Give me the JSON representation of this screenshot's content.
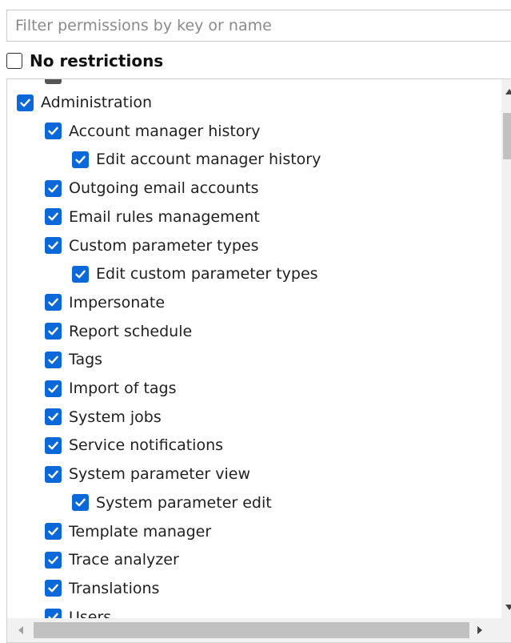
{
  "filter": {
    "placeholder": "Filter permissions by key or name",
    "value": ""
  },
  "no_restrictions": {
    "label": "No restrictions",
    "checked": false
  },
  "tree": {
    "partial_top_item": {
      "checked": true
    },
    "items": [
      {
        "label": "Administration",
        "level": 0,
        "checked": true
      },
      {
        "label": "Account manager history",
        "level": 1,
        "checked": true
      },
      {
        "label": "Edit account manager history",
        "level": 2,
        "checked": true
      },
      {
        "label": "Outgoing email accounts",
        "level": 1,
        "checked": true
      },
      {
        "label": "Email rules management",
        "level": 1,
        "checked": true
      },
      {
        "label": "Custom parameter types",
        "level": 1,
        "checked": true
      },
      {
        "label": "Edit custom parameter types",
        "level": 2,
        "checked": true
      },
      {
        "label": "Impersonate",
        "level": 1,
        "checked": true
      },
      {
        "label": "Report schedule",
        "level": 1,
        "checked": true
      },
      {
        "label": "Tags",
        "level": 1,
        "checked": true
      },
      {
        "label": "Import of tags",
        "level": 1,
        "checked": true
      },
      {
        "label": "System jobs",
        "level": 1,
        "checked": true
      },
      {
        "label": "Service notifications",
        "level": 1,
        "checked": true
      },
      {
        "label": "System parameter view",
        "level": 1,
        "checked": true
      },
      {
        "label": "System parameter edit",
        "level": 2,
        "checked": true
      },
      {
        "label": "Template manager",
        "level": 1,
        "checked": true
      },
      {
        "label": "Trace analyzer",
        "level": 1,
        "checked": true
      },
      {
        "label": "Translations",
        "level": 1,
        "checked": true
      },
      {
        "label": "Users",
        "level": 1,
        "checked": true
      }
    ]
  },
  "colors": {
    "checkbox_checked": "#0a68d9",
    "scrollbar_track": "#f1f1f1",
    "scrollbar_thumb": "#c1c1c1"
  }
}
